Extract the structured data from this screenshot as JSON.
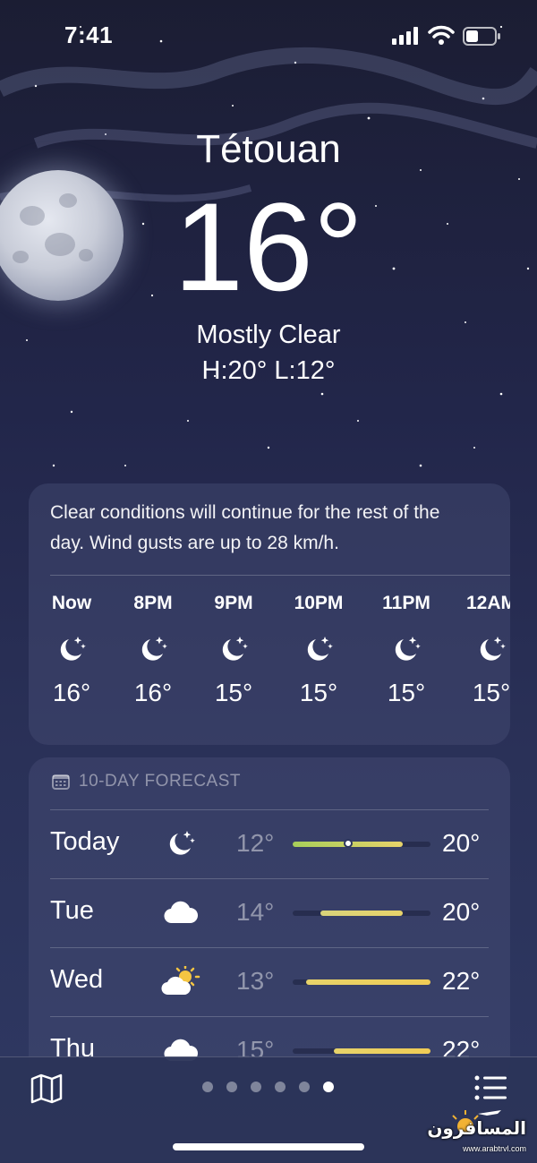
{
  "status": {
    "time": "7:41"
  },
  "location": {
    "city": "Tétouan",
    "temperature": "16°",
    "condition": "Mostly Clear",
    "high_low": "H:20°  L:12°"
  },
  "hourly": {
    "summary": "Clear conditions will continue for the rest of the day. Wind gusts are up to 28 km/h.",
    "hours": [
      {
        "label": "Now",
        "icon": "moon-stars-icon",
        "temp": "16°"
      },
      {
        "label": "8PM",
        "icon": "moon-stars-icon",
        "temp": "16°"
      },
      {
        "label": "9PM",
        "icon": "moon-stars-icon",
        "temp": "15°"
      },
      {
        "label": "10PM",
        "icon": "moon-stars-icon",
        "temp": "15°"
      },
      {
        "label": "11PM",
        "icon": "moon-stars-icon",
        "temp": "15°"
      },
      {
        "label": "12AM",
        "icon": "moon-stars-icon",
        "temp": "15°"
      }
    ]
  },
  "forecast": {
    "header": "10-DAY FORECAST",
    "range_min": 12,
    "range_max": 22,
    "days": [
      {
        "day": "Today",
        "icon": "moon-stars-icon",
        "low": "12°",
        "high": "20°",
        "low_value": 12,
        "high_value": 20,
        "current_value": 16,
        "color_start": "#a8cf5a",
        "color_end": "#e7d36a"
      },
      {
        "day": "Tue",
        "icon": "cloud-icon",
        "low": "14°",
        "high": "20°",
        "low_value": 14,
        "high_value": 20,
        "color_start": "#d9d37a",
        "color_end": "#e7d36a"
      },
      {
        "day": "Wed",
        "icon": "sun-cloud-icon",
        "low": "13°",
        "high": "22°",
        "low_value": 13,
        "high_value": 22,
        "color_start": "#e7d36a",
        "color_end": "#f0cc55"
      },
      {
        "day": "Thu",
        "icon": "cloud-icon",
        "low": "15°",
        "high": "22°",
        "low_value": 15,
        "high_value": 22,
        "color_start": "#e7d36a",
        "color_end": "#f0cc55"
      }
    ]
  },
  "bottom_bar": {
    "page_count": 6,
    "active_page": 5
  },
  "watermark": {
    "text": "المسافرون",
    "site": "www.arabtrvl.com"
  }
}
